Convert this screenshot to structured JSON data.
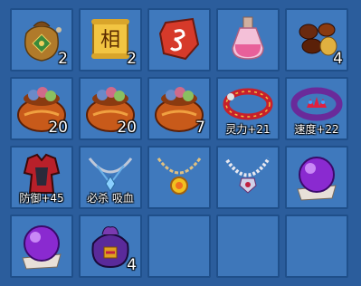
{
  "inventory": {
    "slots": [
      {
        "item": "gold-pouch",
        "count": "2"
      },
      {
        "item": "xiang-scroll",
        "count": "2",
        "glyph": "相"
      },
      {
        "item": "red-rune-stone",
        "count": ""
      },
      {
        "item": "pink-potion",
        "count": ""
      },
      {
        "item": "seeds",
        "count": "4"
      },
      {
        "item": "treasure-pot",
        "count": "20"
      },
      {
        "item": "treasure-pot",
        "count": "20"
      },
      {
        "item": "treasure-pot",
        "count": "7"
      },
      {
        "item": "red-bracelet",
        "bonus": "灵力+21"
      },
      {
        "item": "demon-bracelet",
        "bonus": "速度+22"
      },
      {
        "item": "red-armor",
        "bonus": "防御+45"
      },
      {
        "item": "necklace-ice",
        "bonus": "必杀 吸血"
      },
      {
        "item": "necklace-sun",
        "bonus": ""
      },
      {
        "item": "necklace-pearl",
        "bonus": ""
      },
      {
        "item": "purple-orb",
        "count": ""
      },
      {
        "item": "purple-orb",
        "count": ""
      },
      {
        "item": "purple-pouch",
        "count": "4"
      },
      {
        "item": "empty"
      },
      {
        "item": "empty"
      },
      {
        "item": "empty"
      }
    ]
  },
  "colors": {
    "background": "#2b5d9c",
    "slot": "#3f79bd",
    "slot_border": "#1f4f8a"
  }
}
